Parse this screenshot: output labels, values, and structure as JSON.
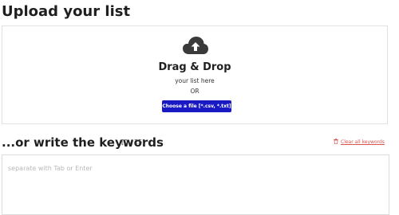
{
  "upload": {
    "title": "Upload your list",
    "dropzone": {
      "icon": "cloud-upload-icon",
      "heading": "Drag & Drop",
      "sub": "your list here",
      "or": "OR",
      "button_label": "Choose a file [*.csv, *.txt]"
    }
  },
  "keywords": {
    "title": "...or write the keywords",
    "counter": "[0 / 25]",
    "clear_label": "Clear all keywords",
    "placeholder": "separate with Tab or Enter",
    "value": ""
  },
  "colors": {
    "button": "#1a1ac4",
    "clear_link": "#d9534f",
    "icon": "#3a3a3a"
  }
}
